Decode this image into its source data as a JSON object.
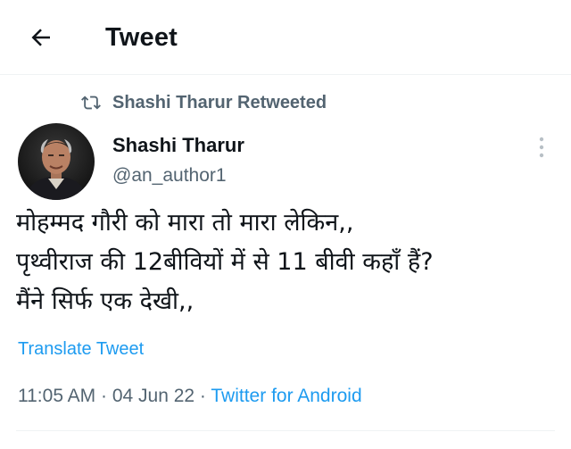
{
  "header": {
    "title": "Tweet",
    "back_icon": "arrow-left-icon"
  },
  "retweet": {
    "icon": "retweet-icon",
    "label": "Shashi Tharur Retweeted"
  },
  "author": {
    "display_name": "Shashi Tharur",
    "handle": "@an_author1",
    "avatar": "profile-photo"
  },
  "more_icon": "more-vertical-icon",
  "tweet": {
    "lines": [
      "मोहम्मद गौरी को मारा तो मारा लेकिन,,",
      "पृथ्वीराज की 12बीवियों में से 11 बीवी कहाँ हैं?",
      "मैंने सिर्फ एक देखी,,"
    ]
  },
  "translate_label": "Translate Tweet",
  "meta": {
    "time": "11:05 AM",
    "separator": " · ",
    "date": "04 Jun 22",
    "source": "Twitter for Android"
  },
  "colors": {
    "accent": "#1d9bf0",
    "secondary_text": "#536471",
    "primary_text": "#0f1419",
    "divider": "#eff3f4"
  }
}
